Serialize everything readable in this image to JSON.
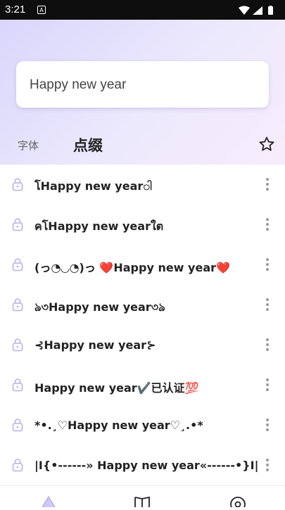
{
  "status_bar": {
    "time": "3:21",
    "notification_glyph": "A"
  },
  "search": {
    "value": "Happy new year"
  },
  "tabs": {
    "font": "字体",
    "decoration": "点缀"
  },
  "items": [
    {
      "text": "โHappy new yearါ"
    },
    {
      "text": "คโHappy new yearใต"
    },
    {
      "text": "(っ◔◡◔)っ ❤️Happy new year❤️"
    },
    {
      "text": "ঌ৩Happy new year৩ঌ"
    },
    {
      "text": "⊰Happy new year⊱"
    },
    {
      "text": "Happy new year✔️已认证💯"
    },
    {
      "text": "*•.¸♡Happy new year♡¸.•*"
    },
    {
      "text": "|I{•------» Happy new year«------•}I|"
    }
  ],
  "icons": {
    "lock": "lock-icon",
    "more": "more-vertical-icon",
    "star": "star-icon",
    "nav": [
      "home-icon",
      "book-icon",
      "settings-icon"
    ]
  },
  "colors": {
    "accent": "#d9d3fb",
    "lock": "#b8b2e6",
    "hero_start": "#d9d6fb",
    "hero_end": "#f7ecfb"
  }
}
